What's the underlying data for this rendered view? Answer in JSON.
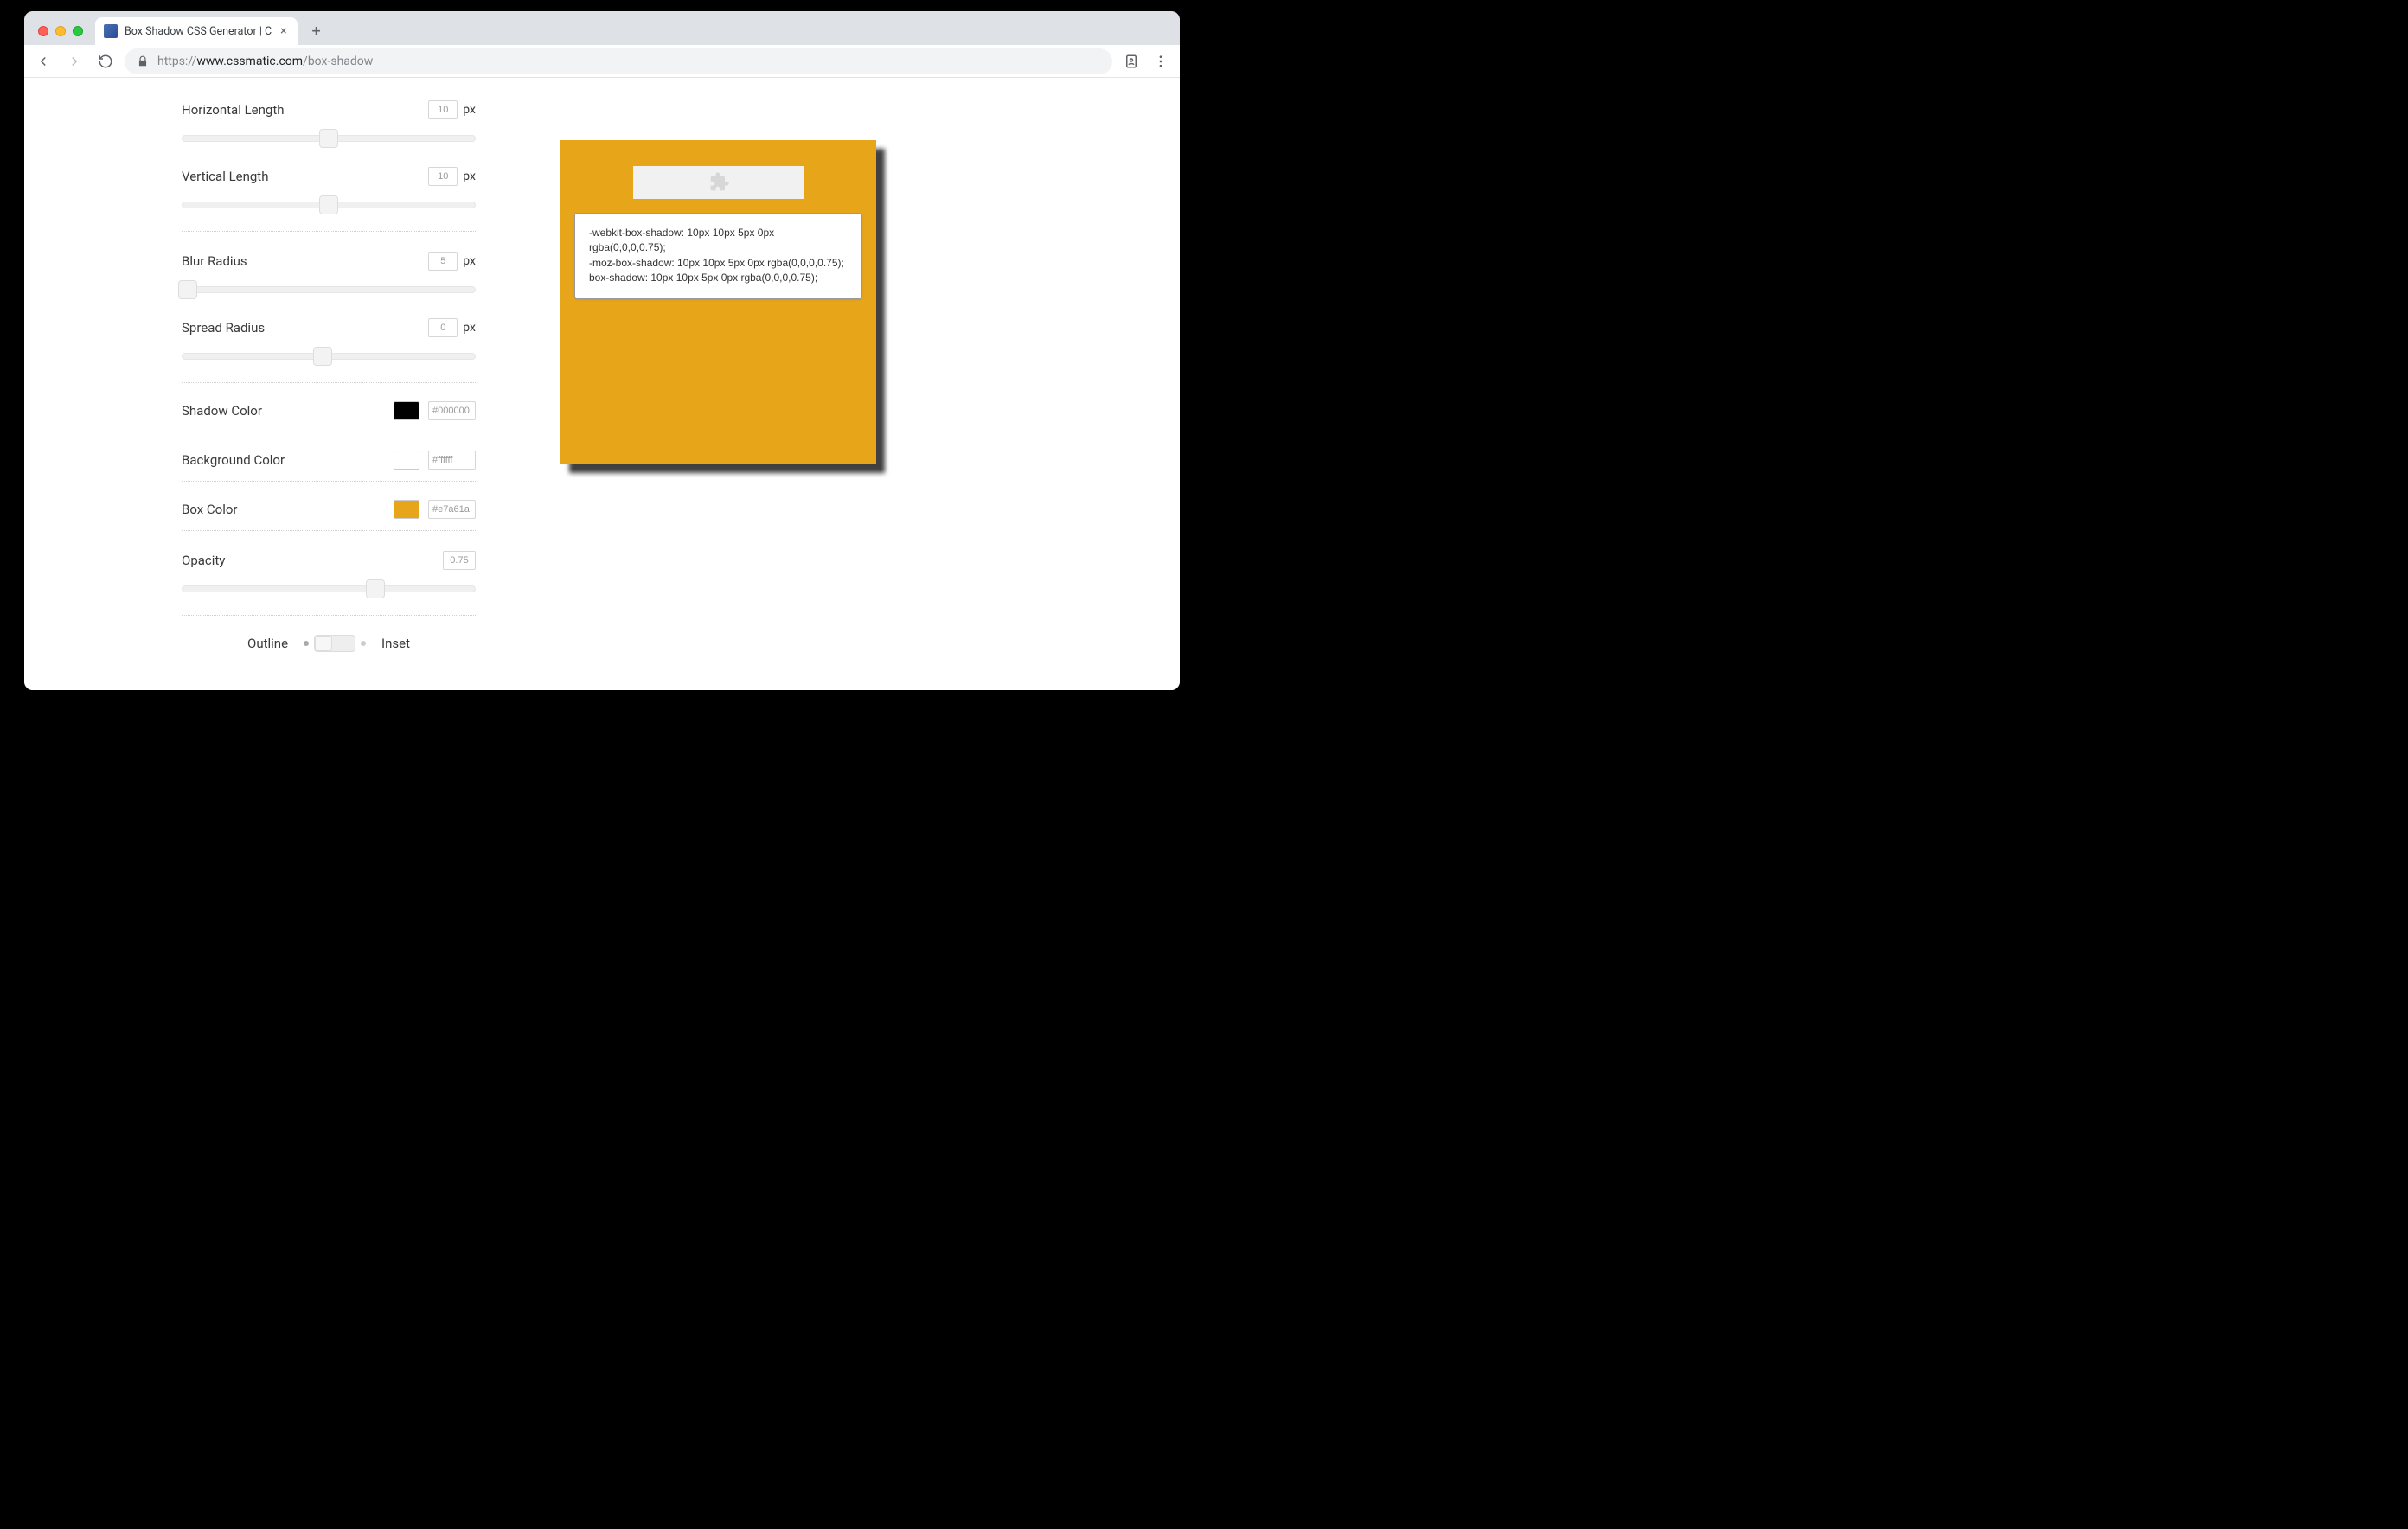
{
  "browser": {
    "tab_title": "Box Shadow CSS Generator | C",
    "url_proto": "https://",
    "url_host": "www.cssmatic.com",
    "url_path": "/box-shadow"
  },
  "controls": {
    "horizontal": {
      "label": "Horizontal Length",
      "value": "10",
      "unit": "px",
      "pct": 50
    },
    "vertical": {
      "label": "Vertical Length",
      "value": "10",
      "unit": "px",
      "pct": 50
    },
    "blur": {
      "label": "Blur Radius",
      "value": "5",
      "unit": "px",
      "pct": 2
    },
    "spread": {
      "label": "Spread Radius",
      "value": "0",
      "unit": "px",
      "pct": 48
    },
    "shadow_color": {
      "label": "Shadow Color",
      "hex": "#000000",
      "swatch": "#000000"
    },
    "bg_color": {
      "label": "Background Color",
      "hex": "#ffffff",
      "swatch": "#ffffff"
    },
    "box_color": {
      "label": "Box Color",
      "hex": "#e7a61a",
      "swatch": "#e7a61a"
    },
    "opacity": {
      "label": "Opacity",
      "value": "0.75",
      "pct": 66
    },
    "toggle": {
      "left": "Outline",
      "right": "Inset"
    }
  },
  "preview": {
    "code_line1": "-webkit-box-shadow: 10px 10px 5px 0px rgba(0,0,0,0.75);",
    "code_line2": "-moz-box-shadow: 10px 10px 5px 0px rgba(0,0,0,0.75);",
    "code_line3": "box-shadow: 10px 10px 5px 0px rgba(0,0,0,0.75);"
  }
}
